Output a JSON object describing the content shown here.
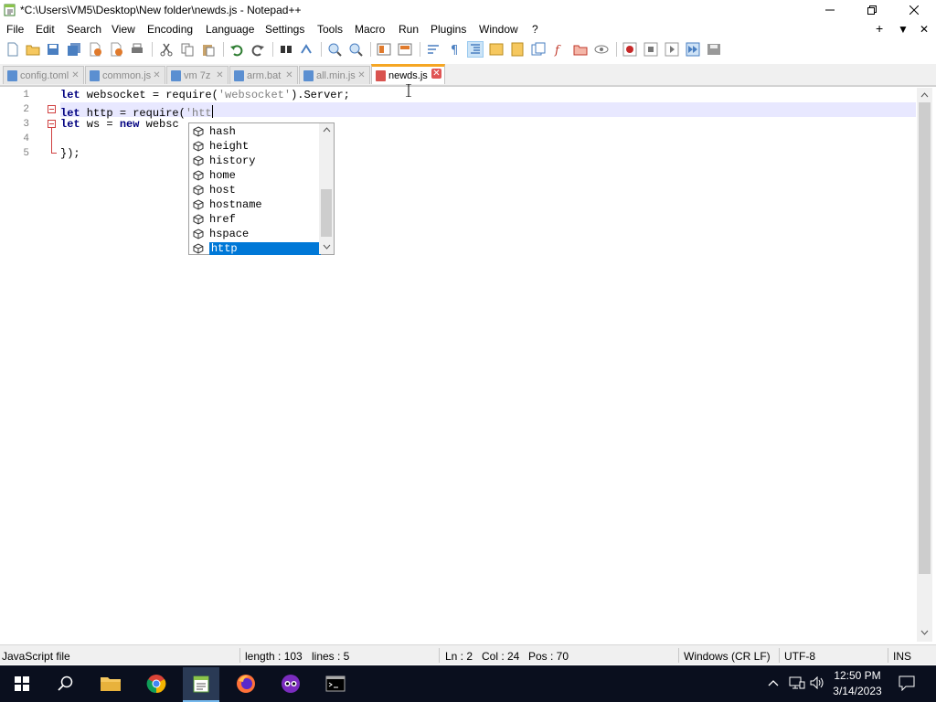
{
  "window": {
    "title": "*C:\\Users\\VM5\\Desktop\\New folder\\newds.js - Notepad++",
    "minimize_icon": "minimize-icon",
    "restore_icon": "restore-icon",
    "close_icon": "close-icon"
  },
  "menu": {
    "items": [
      "File",
      "Edit",
      "Search",
      "View",
      "Encoding",
      "Language",
      "Settings",
      "Tools",
      "Macro",
      "Run",
      "Plugins",
      "Window",
      "?"
    ],
    "right": [
      "+",
      "▼",
      "✕"
    ]
  },
  "tabs": [
    {
      "label": "config.toml",
      "active": false
    },
    {
      "label": "common.js",
      "active": false
    },
    {
      "label": "vm 7z",
      "active": false
    },
    {
      "label": "arm.bat",
      "active": false
    },
    {
      "label": "all.min.js",
      "active": false
    },
    {
      "label": "newds.js",
      "active": true
    }
  ],
  "editor": {
    "line_numbers": [
      "1",
      "2",
      "3",
      "4",
      "5"
    ],
    "lines": [
      {
        "kw": "let",
        "t1": " websocket = require(",
        "str": "'websocket'",
        "t2": ").Server;"
      },
      {
        "kw": "let",
        "t1": " http = require(",
        "str": "'htt",
        "t2": ""
      },
      {
        "kw": "let",
        "t1": " ws = ",
        "kw2": "new",
        "t2": " websc"
      },
      {
        "kw": "",
        "t1": "",
        "str": "",
        "t2": ""
      },
      {
        "kw": "",
        "t1": "});",
        "str": "",
        "t2": ""
      }
    ],
    "current_line": 2
  },
  "autocomplete": {
    "items": [
      "hash",
      "height",
      "history",
      "home",
      "host",
      "hostname",
      "href",
      "hspace",
      "http"
    ],
    "selected": "http",
    "item_icon": "cube-icon"
  },
  "status": {
    "file_type": "JavaScript file",
    "length": "length : 103",
    "lines": "lines : 5",
    "ln": "Ln : 2",
    "col": "Col : 24",
    "pos": "Pos : 70",
    "eol": "Windows (CR LF)",
    "encoding": "UTF-8",
    "mode": "INS"
  },
  "taskbar": {
    "time": "12:50 PM",
    "date": "3/14/2023",
    "apps": [
      "start-icon",
      "search-icon",
      "file-explorer-icon",
      "chrome-icon",
      "notepadpp-icon",
      "firefox-icon",
      "app-icon",
      "terminal-icon"
    ]
  },
  "colors": {
    "keyword": "#000080",
    "string": "#808080",
    "selection": "#0078d7",
    "current_line": "#e8e8ff",
    "active_tab_accent": "#f5a623"
  }
}
